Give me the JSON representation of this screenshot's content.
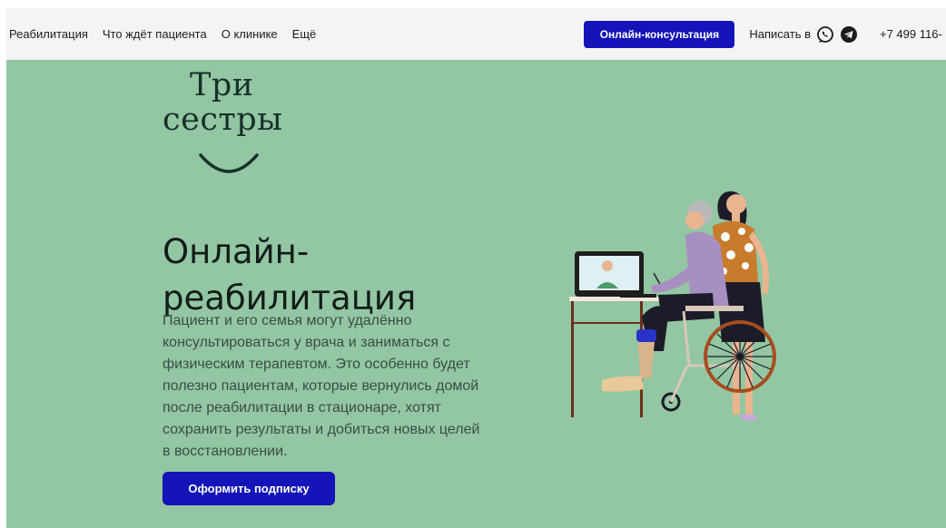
{
  "nav": {
    "links": [
      "Реабилитация",
      "Что ждёт пациента",
      "О клинике",
      "Ещё"
    ],
    "cta": "Онлайн-консультация",
    "write_label": "Написать в",
    "phone": "+7 499 116-"
  },
  "brand": {
    "line1": "Три",
    "line2": "сестры"
  },
  "hero": {
    "title_line1": "Онлайн-",
    "title_line2": "реабилитация",
    "description": "Пациент и его семья могут удалённо консультироваться у врача и заниматься с физическим терапевтом. Это особенно будет полезно пациентам, которые вернулись домой после реабилитации в стационаре, хотят сохранить результаты и добиться новых целей в восстановлении.",
    "button": "Оформить подписку"
  },
  "icons": {
    "whatsapp": "whatsapp-icon",
    "telegram": "telegram-icon"
  },
  "colors": {
    "background": "#93c6a3",
    "nav_background": "#f4f4f4",
    "accent": "#1414b8",
    "heading": "#121d1a",
    "body_text": "#3a4d45"
  }
}
